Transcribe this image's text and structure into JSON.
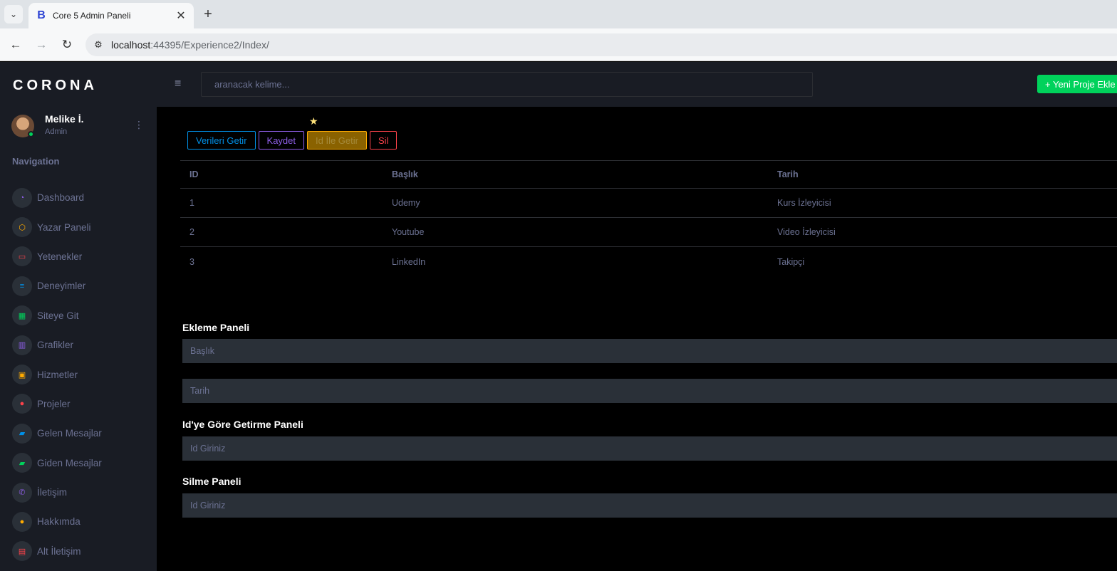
{
  "browser": {
    "tab_title": "Core 5 Admin Paneli",
    "tab_favicon": "B",
    "url_host": "localhost",
    "url_path": ":44395/Experience2/Index/"
  },
  "sidebar": {
    "brand": "CORONA",
    "profile": {
      "name": "Melike İ.",
      "role": "Admin"
    },
    "nav_heading": "Navigation",
    "items": [
      {
        "label": "Dashboard",
        "icon": "speedometer-icon",
        "color": "#8f5fe8"
      },
      {
        "label": "Yazar Paneli",
        "icon": "cube-icon",
        "color": "#ffab00"
      },
      {
        "label": "Yetenekler",
        "icon": "laptop-icon",
        "color": "#fc424a"
      },
      {
        "label": "Deneyimler",
        "icon": "list-icon",
        "color": "#0090e7"
      },
      {
        "label": "Siteye Git",
        "icon": "table-icon",
        "color": "#00d25b"
      },
      {
        "label": "Grafikler",
        "icon": "chart-icon",
        "color": "#8f5fe8"
      },
      {
        "label": "Hizmetler",
        "icon": "contacts-icon",
        "color": "#ffab00"
      },
      {
        "label": "Projeler",
        "icon": "github-icon",
        "color": "#fc424a"
      },
      {
        "label": "Gelen Mesajlar",
        "icon": "message-icon",
        "color": "#0090e7"
      },
      {
        "label": "Giden Mesajlar",
        "icon": "message-icon",
        "color": "#00d25b"
      },
      {
        "label": "İletişim",
        "icon": "phone-icon",
        "color": "#8f5fe8"
      },
      {
        "label": "Hakkımda",
        "icon": "user-icon",
        "color": "#ffab00"
      },
      {
        "label": "Alt İletişim",
        "icon": "calendar-icon",
        "color": "#fc424a"
      }
    ]
  },
  "topnav": {
    "search_placeholder": "aranacak kelime...",
    "new_project": "+ Yeni Proje Ekle"
  },
  "actions": {
    "get_all": "Verileri Getir",
    "save": "Kaydet",
    "get_by_id": "Id İle Getir",
    "delete": "Sil"
  },
  "table": {
    "headers": [
      "ID",
      "Başlık",
      "Tarih"
    ],
    "rows": [
      [
        "1",
        "Udemy",
        "Kurs İzleyicisi"
      ],
      [
        "2",
        "Youtube",
        "Video İzleyicisi"
      ],
      [
        "3",
        "LinkedIn",
        "Takipçi"
      ]
    ]
  },
  "panels": {
    "add_title": "Ekleme Paneli",
    "add_title_placeholder": "Başlık",
    "add_date_placeholder": "Tarih",
    "get_title": "Id'ye Göre Getirme Paneli",
    "get_placeholder": "Id Giriniz",
    "delete_title": "Silme Paneli",
    "delete_placeholder": "Id Giriniz"
  }
}
